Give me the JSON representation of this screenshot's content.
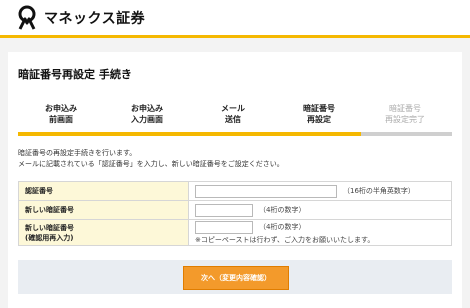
{
  "header": {
    "logo_text": "マネックス証券"
  },
  "page": {
    "title": "暗証番号再設定 手続き"
  },
  "steps": [
    {
      "line1": "お申込み",
      "line2": "前画面"
    },
    {
      "line1": "お申込み",
      "line2": "入力画面"
    },
    {
      "line1": "メール",
      "line2": "送信"
    },
    {
      "line1": "暗証番号",
      "line2": "再設定"
    },
    {
      "line1": "暗証番号",
      "line2": "再設定完了"
    }
  ],
  "progress": {
    "completed_steps": 4,
    "total_steps": 5
  },
  "description": {
    "line1": "暗証番号の再設定手続きを行います。",
    "line2": "メールに記載されている「認証番号」を入力し、新しい暗証番号をご設定ください。"
  },
  "form": {
    "auth": {
      "label": "認証番号",
      "value": "",
      "hint": "（16桁の半角英数字）"
    },
    "new": {
      "label": "新しい暗証番号",
      "value": "",
      "hint": "（4桁の数字）"
    },
    "confirm": {
      "label1": "新しい暗証番号",
      "label2": "(確認用再入力)",
      "value": "",
      "hint": "（4桁の数字）",
      "note": "※コピーペーストは行わず、ご入力をお願いいたします。"
    }
  },
  "actions": {
    "next_label": "次へ（変更内容確認）"
  },
  "colors": {
    "accent": "#f5b800",
    "button": "#f39a2b",
    "label_bg": "#fdf8d8"
  }
}
